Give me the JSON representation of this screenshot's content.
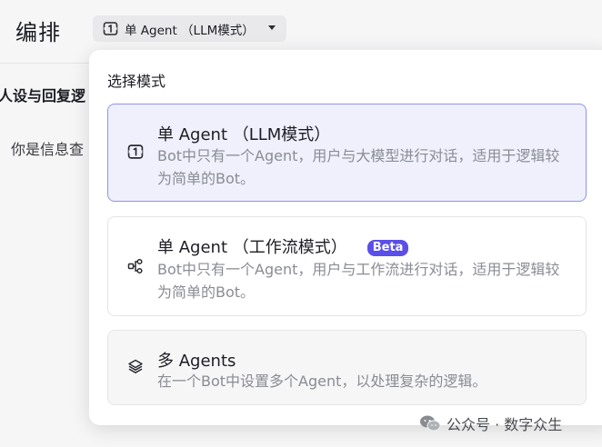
{
  "header": {
    "title": "编排",
    "mode_selector_label": "单 Agent （LLM模式）"
  },
  "background": {
    "section_title": "人设与回复逻",
    "prompt_text": "你是信息查"
  },
  "dropdown": {
    "heading": "选择模式",
    "options": [
      {
        "title": "单 Agent （LLM模式）",
        "description": "Bot中只有一个Agent，用户与大模型进行对话，适用于逻辑较为简单的Bot。",
        "icon": "single-agent-icon",
        "selected": true
      },
      {
        "title": "单 Agent （工作流模式）",
        "badge": "Beta",
        "description": "Bot中只有一个Agent，用户与工作流进行对话，适用于逻辑较为简单的Bot。",
        "icon": "workflow-icon",
        "selected": false
      },
      {
        "title": "多 Agents",
        "description": "在一个Bot中设置多个Agent，以处理复杂的逻辑。",
        "icon": "layers-icon",
        "selected": false
      }
    ]
  },
  "watermark": {
    "text": "公众号 · 数字众生"
  },
  "colors": {
    "selected_bg": "#eff0fc",
    "selected_border": "#8d93e8",
    "badge_bg": "#5b4fe9"
  }
}
